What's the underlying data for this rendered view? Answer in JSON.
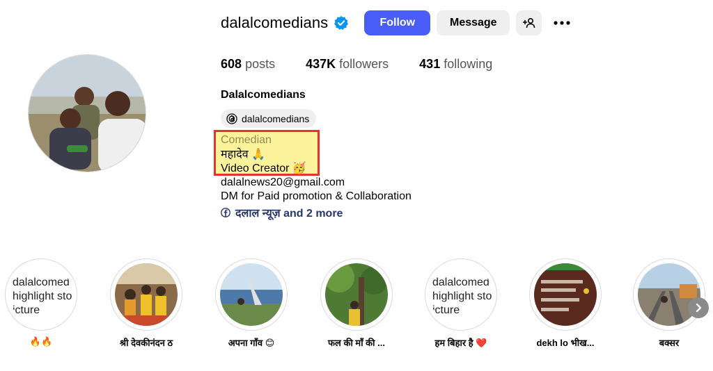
{
  "profile": {
    "username": "dalalcomedians",
    "display_name": "Dalalcomedians",
    "threads_handle": "dalalcomedians",
    "follow_label": "Follow",
    "message_label": "Message"
  },
  "stats": {
    "posts_count": "608",
    "posts_label": "posts",
    "followers_count": "437K",
    "followers_label": "followers",
    "following_count": "431",
    "following_label": "following"
  },
  "bio": {
    "category": "Comedian",
    "line1": "महादेव 🙏",
    "line2": "Video Creator 🥳",
    "email": "dalalnews20@gmail.com",
    "dm_line": "DM for Paid promotion & Collaboration",
    "links": "दलाल न्यूज़ and 2 more"
  },
  "highlights": [
    {
      "caption": "🔥🔥",
      "alt1": "dalalcomed",
      "alt2": "highlight sto",
      "alt3": "icture"
    },
    {
      "caption": "श्री देवकीनंदन ठ"
    },
    {
      "caption": "अपना गाँव 😊"
    },
    {
      "caption": "फल की माँ की ..."
    },
    {
      "caption": "हम बिहार है ❤️",
      "alt1": "dalalcomed",
      "alt2": "highlight sto",
      "alt3": "icture"
    },
    {
      "caption": "dekh lo भीख..."
    },
    {
      "caption": "बक्सर"
    }
  ],
  "colors": {
    "accent": "#4a5df9",
    "verified": "#0095f6",
    "highlight_box": "#e8322e",
    "highlight_fill": "#fdf39a"
  }
}
